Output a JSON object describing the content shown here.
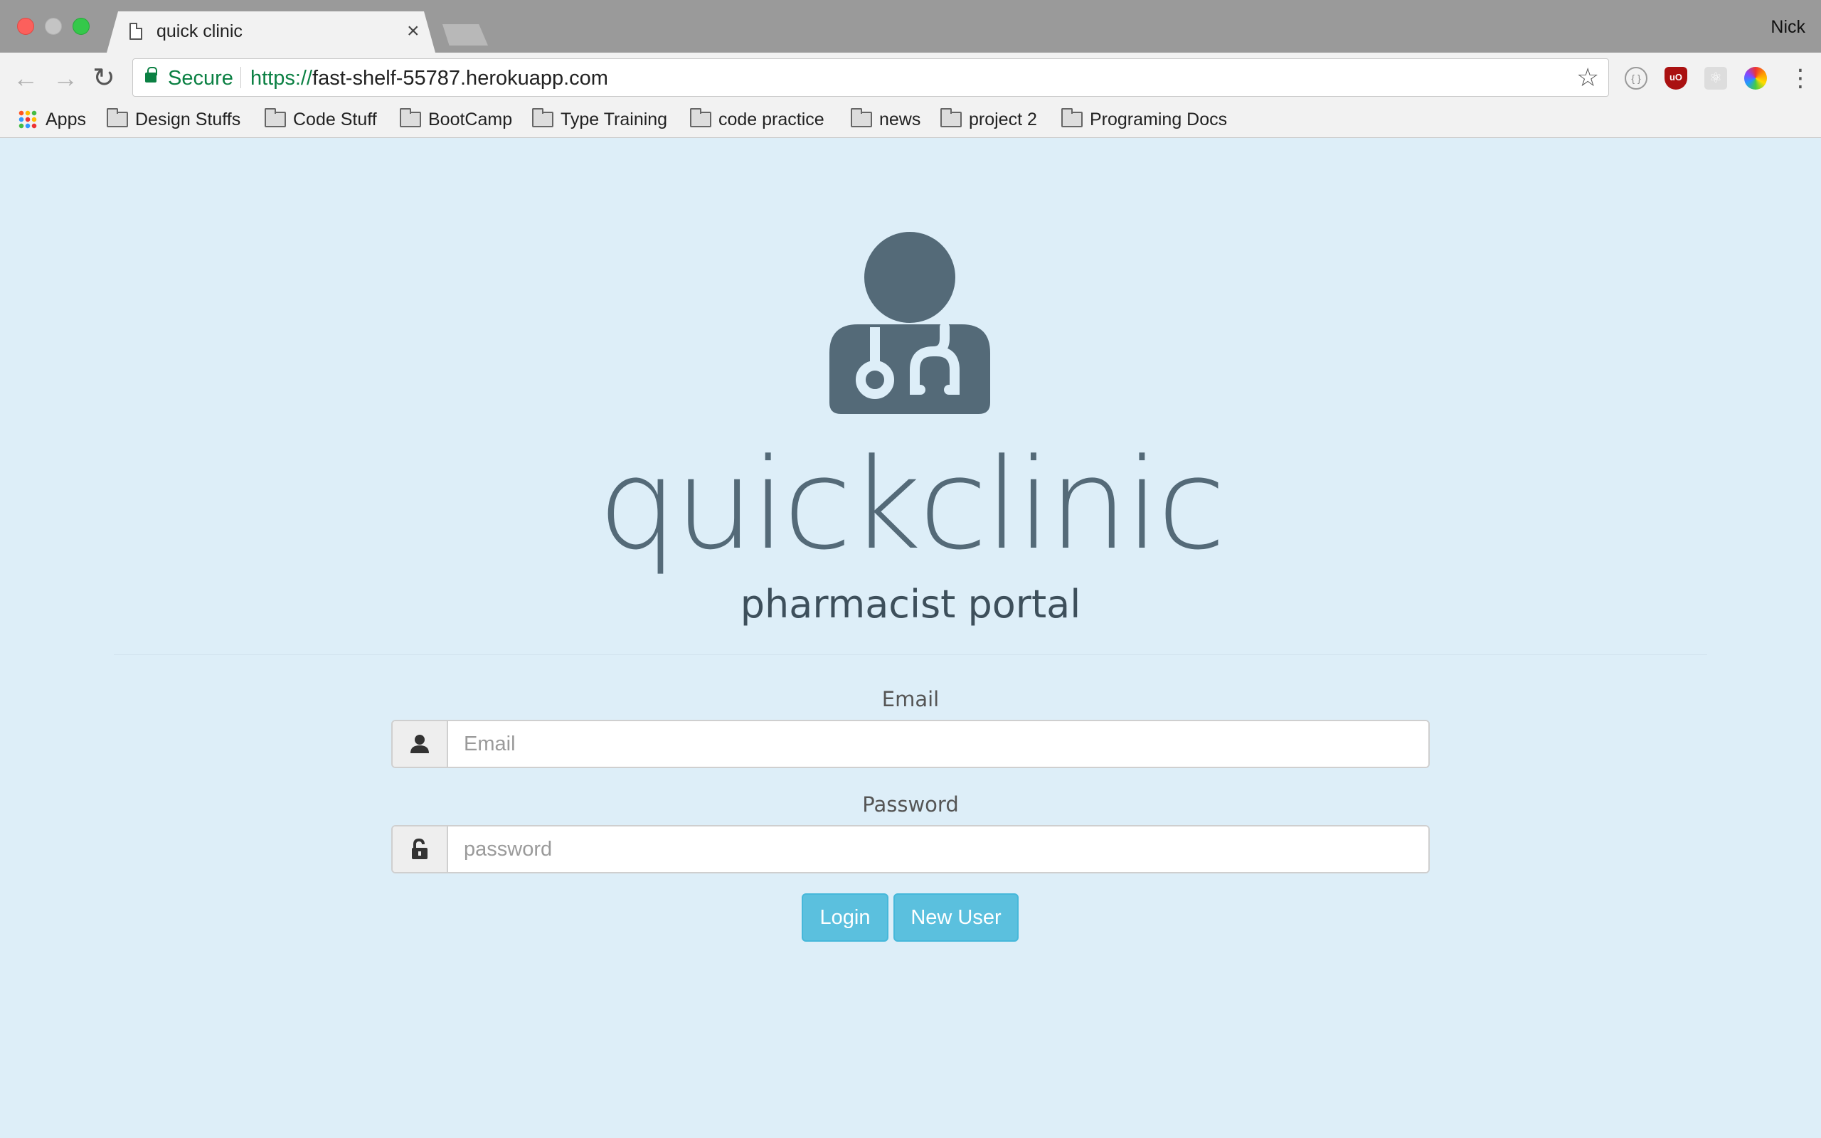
{
  "browser": {
    "tab_title": "quick clinic",
    "tab_close": "×",
    "profile_name": "Nick",
    "omnibox": {
      "secure_label": "Secure",
      "url_scheme": "https://",
      "url_host": "fast-shelf-55787.herokuapp.com"
    },
    "bookmarks": [
      "Apps",
      "Design Stuffs",
      "Code Stuff",
      "BootCamp",
      "Type Training",
      "code practice",
      "news",
      "project 2",
      "Programing Docs"
    ]
  },
  "page": {
    "brand": "quickclinic",
    "subtitle": "pharmacist portal",
    "email": {
      "label": "Email",
      "placeholder": "Email",
      "value": ""
    },
    "password": {
      "label": "Password",
      "placeholder": "password",
      "value": ""
    },
    "buttons": {
      "login": "Login",
      "new_user": "New User"
    },
    "colors": {
      "page_bg": "#ddeef8",
      "brand": "#546a78",
      "button": "#5bc0de",
      "secure_green": "#0b8043"
    },
    "icons": [
      "doctor-icon",
      "user-icon",
      "unlock-icon"
    ]
  }
}
